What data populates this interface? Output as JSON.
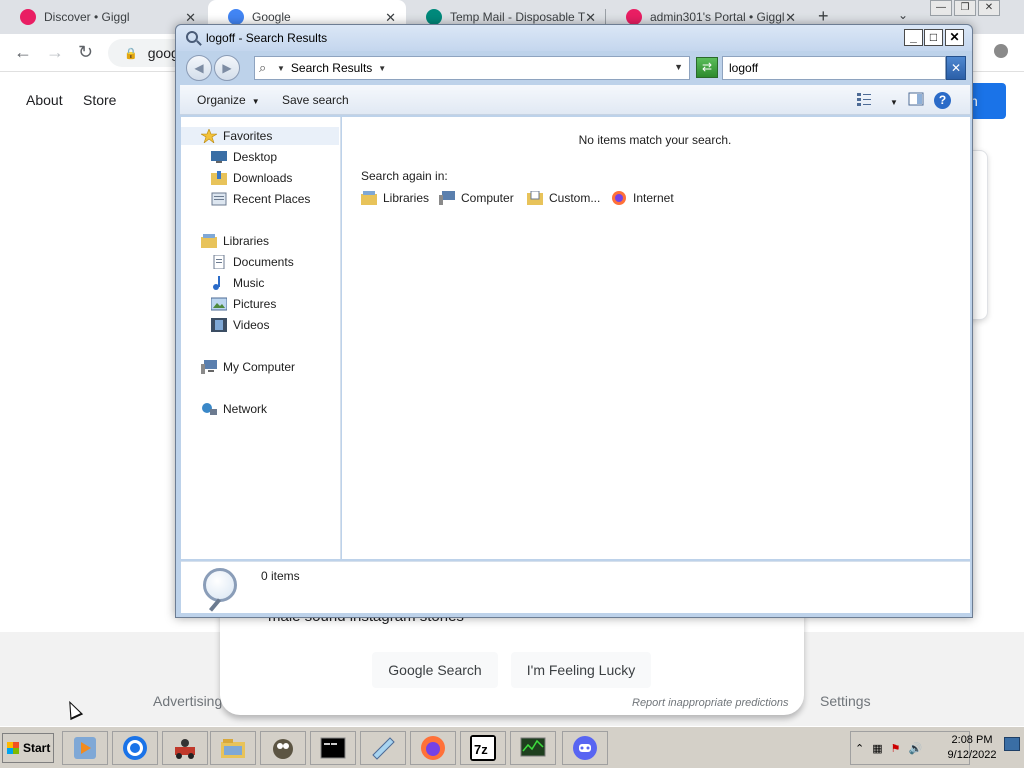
{
  "browser": {
    "tabs": [
      {
        "title": "Discover • Giggl",
        "favicon_color": "#e91e63",
        "active": false
      },
      {
        "title": "Google",
        "favicon_color": "#4285f4",
        "active": true
      },
      {
        "title": "Temp Mail - Disposable T",
        "favicon_color": "#00897b",
        "active": false
      },
      {
        "title": "admin301's Portal • Giggl",
        "favicon_color": "#e91e63",
        "active": false
      }
    ],
    "tab_close_glyph": "✕",
    "new_tab_glyph": "+",
    "tab_search_glyph": "⌄",
    "window_buttons": [
      "—",
      "❐",
      "✕"
    ],
    "address": "goog",
    "page": {
      "nav_links": [
        "About",
        "Store"
      ],
      "partial_suggestion": "male sound instagram stories",
      "search_button": "Google Search",
      "lucky_button": "I'm Feeling Lucky",
      "report_link": "Report inappropriate predictions",
      "footer_left": "Advertising",
      "footer_right": "Settings",
      "signin_partial": "n"
    }
  },
  "explorer": {
    "title": "logoff - Search Results",
    "caption_buttons": [
      "_",
      "□",
      "✕"
    ],
    "breadcrumb": "Search Results",
    "search_value": "logoff",
    "toolbar": {
      "organize": "Organize",
      "save_search": "Save search"
    },
    "nav": {
      "favorites": "Favorites",
      "favorites_items": [
        "Desktop",
        "Downloads",
        "Recent Places"
      ],
      "libraries": "Libraries",
      "libraries_items": [
        "Documents",
        "Music",
        "Pictures",
        "Videos"
      ],
      "my_computer": "My Computer",
      "network": "Network"
    },
    "content": {
      "no_items": "No items match your search.",
      "search_again_label": "Search again in:",
      "search_again_items": [
        "Libraries",
        "Computer",
        "Custom...",
        "Internet"
      ]
    },
    "status": "0 items"
  },
  "taskbar": {
    "start_label": "Start",
    "apps": [
      "media-player",
      "chrome",
      "kart-game",
      "file-explorer",
      "gimp",
      "command-prompt",
      "notepad",
      "firefox",
      "7zip",
      "system-monitor",
      "discord"
    ],
    "clock_time": "2:08 PM",
    "clock_date": "9/12/2022"
  },
  "colors": {
    "chrome_tabbar": "#dee1e6",
    "explorer_frame": "#bdd2ea",
    "google_blue": "#1a73e8",
    "taskbar": "#d4d0c8"
  }
}
